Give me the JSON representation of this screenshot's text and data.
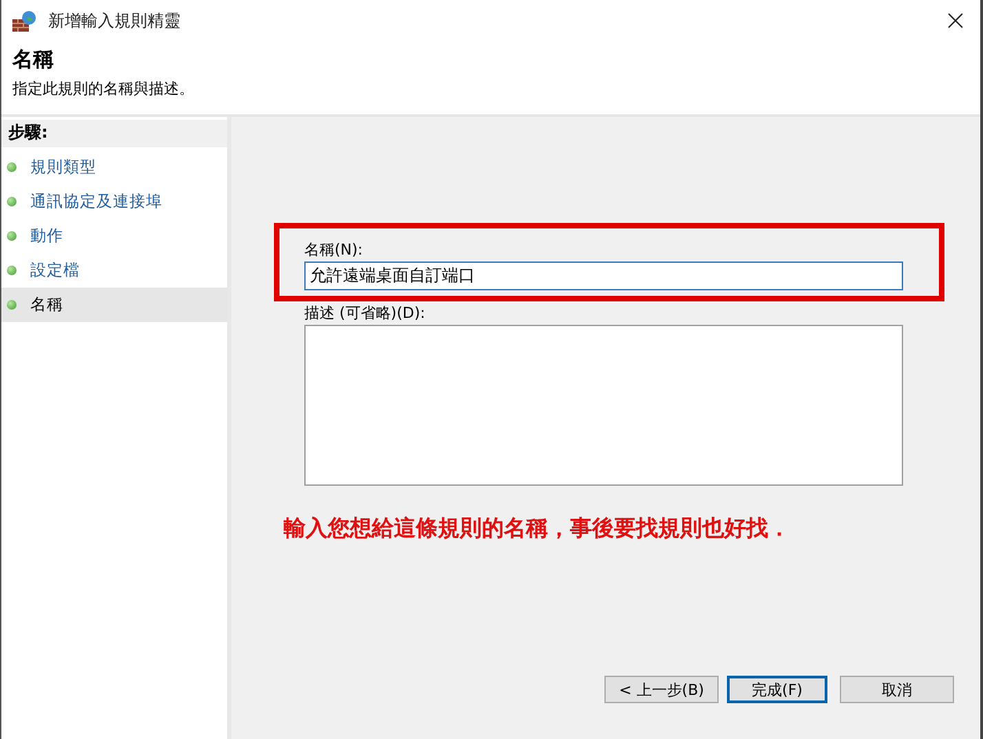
{
  "window": {
    "title": "新增輸入規則精靈"
  },
  "header": {
    "title": "名稱",
    "subtitle": "指定此規則的名稱與描述。"
  },
  "steps": {
    "heading": "步驟:",
    "items": [
      {
        "label": "規則類型",
        "selected": false
      },
      {
        "label": "通訊協定及連接埠",
        "selected": false
      },
      {
        "label": "動作",
        "selected": false
      },
      {
        "label": "設定檔",
        "selected": false
      },
      {
        "label": "名稱",
        "selected": true
      }
    ]
  },
  "form": {
    "name_label": "名稱(N):",
    "name_value": "允許遠端桌面自訂端口",
    "description_label": "描述 (可省略)(D):"
  },
  "annotation": "輸入您想給這條規則的名稱，事後要找規則也好找．",
  "buttons": [
    {
      "label": "< 上一步(B)",
      "default": false
    },
    {
      "label": "完成(F)",
      "default": true
    },
    {
      "label": "取消",
      "default": false
    }
  ]
}
